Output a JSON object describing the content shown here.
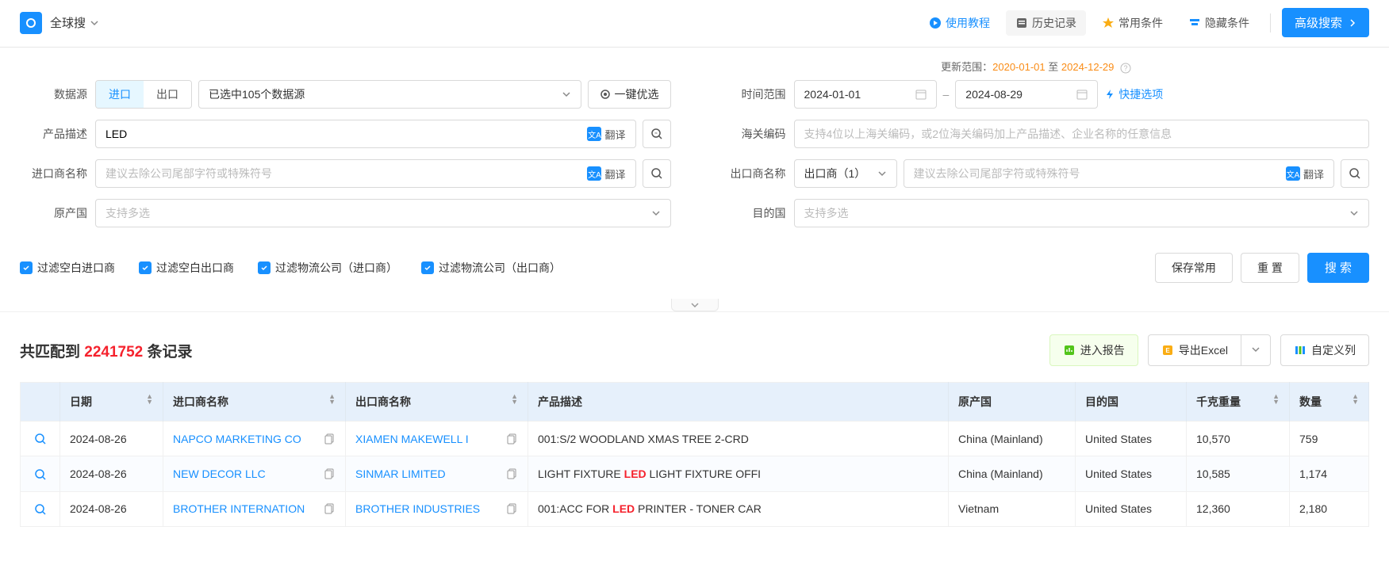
{
  "top": {
    "global_search": "全球搜",
    "tutorial": "使用教程",
    "history": "历史记录",
    "favorites": "常用条件",
    "hidden_cond": "隐藏条件",
    "adv_search": "高级搜索"
  },
  "form": {
    "update_prefix": "更新范围：",
    "update_start": "2020-01-01",
    "update_mid": " 至 ",
    "update_end": "2024-12-29",
    "labels": {
      "data_source": "数据源",
      "time_range": "时间范围",
      "product_desc": "产品描述",
      "hs_code": "海关编码",
      "importer": "进口商名称",
      "exporter": "出口商名称",
      "origin": "原产国",
      "destination": "目的国"
    },
    "tabs": {
      "import": "进口",
      "export": "出口"
    },
    "source_select": "已选中105个数据源",
    "optimize_btn": "一键优选",
    "date_start": "2024-01-01",
    "date_end": "2024-08-29",
    "quick_options": "快捷选项",
    "product_value": "LED",
    "translate": "翻译",
    "hs_placeholder": "支持4位以上海关编码，或2位海关编码加上产品描述、企业名称的任意信息",
    "name_placeholder": "建议去除公司尾部字符或特殊符号",
    "exporter_select": "出口商（1）",
    "multi_placeholder": "支持多选",
    "checkboxes": {
      "c1": "过滤空白进口商",
      "c2": "过滤空白出口商",
      "c3": "过滤物流公司（进口商）",
      "c4": "过滤物流公司（出口商）"
    },
    "save_common": "保存常用",
    "reset": "重 置",
    "search": "搜 索"
  },
  "results": {
    "prefix": "共匹配到 ",
    "count": "2241752",
    "suffix": " 条记录",
    "enter_report": "进入报告",
    "export_excel": "导出Excel",
    "custom_cols": "自定义列"
  },
  "table": {
    "headers": {
      "date": "日期",
      "importer": "进口商名称",
      "exporter": "出口商名称",
      "product": "产品描述",
      "origin": "原产国",
      "dest": "目的国",
      "weight": "千克重量",
      "qty": "数量"
    },
    "rows": [
      {
        "date": "2024-08-26",
        "importer": "NAPCO MARKETING CO",
        "exporter": "XIAMEN MAKEWELL I",
        "product_pre": "001:S/2 WOODLAND XMAS TREE 2-CRD",
        "product_hl": "",
        "product_post": "",
        "origin": "China (Mainland)",
        "dest": "United States",
        "weight": "10,570",
        "qty": "759"
      },
      {
        "date": "2024-08-26",
        "importer": "NEW DECOR LLC",
        "exporter": "SINMAR LIMITED",
        "product_pre": "LIGHT FIXTURE ",
        "product_hl": "LED",
        "product_post": " LIGHT FIXTURE OFFI",
        "origin": "China (Mainland)",
        "dest": "United States",
        "weight": "10,585",
        "qty": "1,174"
      },
      {
        "date": "2024-08-26",
        "importer": "BROTHER INTERNATION",
        "exporter": "BROTHER INDUSTRIES",
        "product_pre": "001:ACC FOR ",
        "product_hl": "LED",
        "product_post": " PRINTER - TONER CAR",
        "origin": "Vietnam",
        "dest": "United States",
        "weight": "12,360",
        "qty": "2,180"
      }
    ]
  }
}
